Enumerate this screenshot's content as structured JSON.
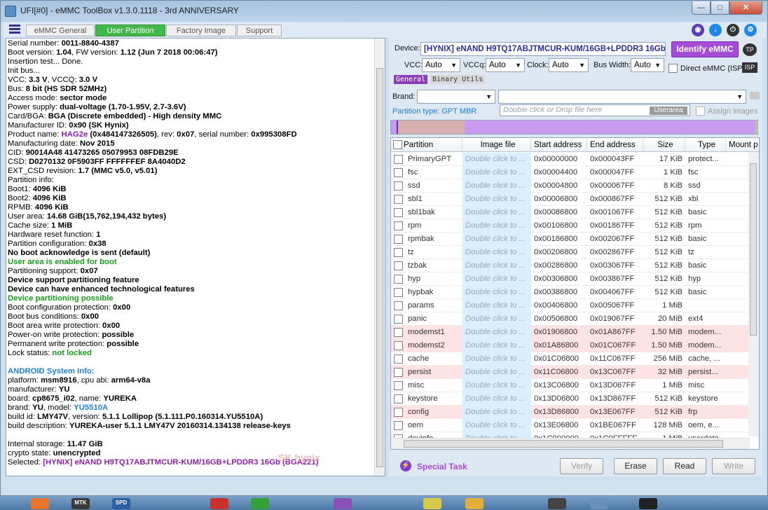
{
  "window": {
    "title": "UFI[#0] - eMMC ToolBox v1.3.0.1118 - 3rd ANNIVERSARY"
  },
  "tabs": [
    {
      "label": "eMMC General"
    },
    {
      "label": "User Partition"
    },
    {
      "label": "Factory Image"
    },
    {
      "label": "Support"
    }
  ],
  "colors": {
    "active_tab": "#42b84a",
    "identify_button": "#a64bd6",
    "partition_bar": "#c89af0"
  },
  "log": [
    {
      "k": "Serial number: ",
      "v": "0011-8840-4387"
    },
    {
      "k": " Boot version: ",
      "v": "1.04",
      "k2": ", FW version: ",
      "v2": "1.12 (Jun  7 2018 00:06:47)"
    },
    {
      "k": "Insertion test... Done."
    },
    {
      "k": "Init bus..."
    },
    {
      "k": "VCC: ",
      "v": "3.3 V",
      "k2": ", VCCQ: ",
      "v2": "3.0 V"
    },
    {
      "k": "Bus: ",
      "v": "8 bit (HS SDR 52MHz)"
    },
    {
      "k": "Access mode: ",
      "v": "sector mode"
    },
    {
      "k": "Power supply: ",
      "v": "dual-voltage (1.70-1.95V, 2.7-3.6V)"
    },
    {
      "k": " Card/BGA: ",
      "v": "BGA (Discrete embedded) - High density MMC"
    },
    {
      "k": " Manufacturer ID: ",
      "v": "0x90 (SK Hynix)"
    },
    {
      "k": " Product name: ",
      "v": "HAG2e",
      "vc": "purple",
      "k2": " ",
      "v2": "(0x484147326505)",
      "k3": ", rev: ",
      "v3": "0x07",
      "k4": ", serial number: ",
      "v4": "0x995308FD"
    },
    {
      "k": " Manufacturing date: ",
      "v": "Nov 2015"
    },
    {
      "k": "CID: ",
      "v": "90014A48 41473265 05079953 08FDB29E"
    },
    {
      "k": "CSD: ",
      "v": "D0270132 0F5903FF FFFFFFEF 8A4040D2"
    },
    {
      "k": "EXT_CSD revision: ",
      "v": "1.7 (MMC v5.0, v5.01)"
    },
    {
      "k": "Partition info:"
    },
    {
      "k": " Boot1: ",
      "v": "4096 KiB"
    },
    {
      "k": " Boot2: ",
      "v": "4096 KiB"
    },
    {
      "k": " RPMB: ",
      "v": "4096 KiB"
    },
    {
      "k": " User area: ",
      "v": "14.68 GiB(15,762,194,432 bytes)"
    },
    {
      "k": "Cache size: ",
      "v": "1 MiB"
    },
    {
      "k": "Hardware reset function: ",
      "v": "1"
    },
    {
      "k": "Partition configuration: ",
      "v": "0x38"
    },
    {
      "k": " ",
      "v": "No boot acknowledge is sent (default)"
    },
    {
      "k": " ",
      "v": "User area is enabled for boot",
      "vc": "green"
    },
    {
      "k": "Partitioning support: ",
      "v": "0x07"
    },
    {
      "k": " ",
      "v": "Device support partitioning feature"
    },
    {
      "k": " ",
      "v": "Device can have enhanced technological features"
    },
    {
      "k": " ",
      "v": "Device partitioning possible",
      "vc": "green"
    },
    {
      "k": "Boot configuration protection: ",
      "v": "0x00"
    },
    {
      "k": "Boot bus conditions: ",
      "v": "0x00"
    },
    {
      "k": "Boot area write protection: ",
      "v": "0x00"
    },
    {
      "k": " Power-on write protection: ",
      "v": "possible"
    },
    {
      "k": " Permanent write protection: ",
      "v": "possible"
    },
    {
      "k": " Lock status: ",
      "v": "not locked",
      "vc": "green"
    },
    {
      "k": ""
    },
    {
      "k": "",
      "v": "ANDROID System Info:",
      "vc": "blue"
    },
    {
      "k": " platform: ",
      "v": "msm8916",
      "k2": ", cpu abi: ",
      "v2": "arm64-v8a"
    },
    {
      "k": " manufacturer: ",
      "v": "YU"
    },
    {
      "k": " board: ",
      "v": "cp8675_i02",
      "k2": ", name: ",
      "v2": "YUREKA"
    },
    {
      "k": " brand: ",
      "v": "YU",
      "k2": ", model: ",
      "v2": "YU5510A",
      "v2c": "blue"
    },
    {
      "k": " build id: ",
      "v": "LMY47V",
      "k2": ", version: ",
      "v2": "5.1.1 Lollipop (5.1.111.P0.160314.YU5510A)"
    },
    {
      "k": " build description: ",
      "v": "YUREKA-user 5.1.1 LMY47V 20160314.134138 release-keys"
    },
    {
      "k": ""
    },
    {
      "k": "Internal storage: ",
      "v": "11.47 GiB"
    },
    {
      "k": "crypto state: ",
      "v": "unencrypted"
    },
    {
      "k": "Selected: ",
      "v": "[HYNIX] eNAND H9TQ17ABJTMCUR-KUM/16GB+LPDDR3 16Gb   (BGA221)",
      "vc": "purple"
    }
  ],
  "watermark": "SK hynix",
  "device": {
    "label": "Device:",
    "value": "[HYNIX] eNAND H9TQ17ABJTMCUR-KUM/16GB+LPDDR3 16Gb",
    "identify_label": "Identify eMMC",
    "tp_label": "TP"
  },
  "power": {
    "vcc_label": "VCC:",
    "vcc_value": "Auto",
    "vccq_label": "VCCq:",
    "vccq_value": "Auto",
    "clock_label": "Clock:",
    "clock_value": "Auto",
    "bus_label": "Bus Width:",
    "bus_value": "Auto",
    "direct_label": "Direct eMMC (ISP)",
    "isp_label": "ISP"
  },
  "subtabs": [
    {
      "label": "General"
    },
    {
      "label": "Binary Utils"
    }
  ],
  "brand": {
    "label": "Brand:",
    "value": "",
    "model_value": ""
  },
  "partition_type": "Partition type: GPT MBR",
  "drop_placeholder": "Double click or Drop file here",
  "userarea_label": "Userarea",
  "assign_images_label": "Assign images",
  "grid": {
    "headers": [
      "Partition",
      "Image file",
      "Start address",
      "End address",
      "Size",
      "Type",
      "Mount p"
    ],
    "image_placeholder": "Double click to ...",
    "rows": [
      {
        "name": "PrimaryGPT",
        "start": "0x00000000",
        "end": "0x000043FF",
        "size": "17 KiB",
        "type": "protect...",
        "pink": false
      },
      {
        "name": "fsc",
        "start": "0x00004400",
        "end": "0x000047FF",
        "size": "1 KiB",
        "type": "fsc",
        "pink": false
      },
      {
        "name": "ssd",
        "start": "0x00004800",
        "end": "0x000067FF",
        "size": "8 KiB",
        "type": "ssd",
        "pink": false
      },
      {
        "name": "sbl1",
        "start": "0x00006800",
        "end": "0x000867FF",
        "size": "512 KiB",
        "type": "xbl",
        "pink": false
      },
      {
        "name": "sbl1bak",
        "start": "0x00086800",
        "end": "0x001067FF",
        "size": "512 KiB",
        "type": "basic",
        "pink": false
      },
      {
        "name": "rpm",
        "start": "0x00106800",
        "end": "0x001867FF",
        "size": "512 KiB",
        "type": "rpm",
        "pink": false
      },
      {
        "name": "rpmbak",
        "start": "0x00186800",
        "end": "0x002067FF",
        "size": "512 KiB",
        "type": "basic",
        "pink": false
      },
      {
        "name": "tz",
        "start": "0x00206800",
        "end": "0x002867FF",
        "size": "512 KiB",
        "type": "tz",
        "pink": false
      },
      {
        "name": "tzbak",
        "start": "0x00286800",
        "end": "0x003067FF",
        "size": "512 KiB",
        "type": "basic",
        "pink": false
      },
      {
        "name": "hyp",
        "start": "0x00306800",
        "end": "0x003867FF",
        "size": "512 KiB",
        "type": "hyp",
        "pink": false
      },
      {
        "name": "hypbak",
        "start": "0x00386800",
        "end": "0x004067FF",
        "size": "512 KiB",
        "type": "basic",
        "pink": false
      },
      {
        "name": "params",
        "start": "0x00406800",
        "end": "0x005067FF",
        "size": "1 MiB",
        "type": "",
        "pink": false
      },
      {
        "name": "panic",
        "start": "0x00506800",
        "end": "0x019067FF",
        "size": "20 MiB",
        "type": "ext4",
        "pink": false
      },
      {
        "name": "modemst1",
        "start": "0x01906800",
        "end": "0x01A867FF",
        "size": "1.50 MiB",
        "type": "modem...",
        "pink": true
      },
      {
        "name": "modemst2",
        "start": "0x01A86800",
        "end": "0x01C067FF",
        "size": "1.50 MiB",
        "type": "modem...",
        "pink": true
      },
      {
        "name": "cache",
        "start": "0x01C06800",
        "end": "0x11C067FF",
        "size": "256 MiB",
        "type": "cache, ...",
        "pink": false
      },
      {
        "name": "persist",
        "start": "0x11C06800",
        "end": "0x13C067FF",
        "size": "32 MiB",
        "type": "persist...",
        "pink": true
      },
      {
        "name": "misc",
        "start": "0x13C06800",
        "end": "0x13D067FF",
        "size": "1 MiB",
        "type": "misc",
        "pink": false
      },
      {
        "name": "keystore",
        "start": "0x13D06800",
        "end": "0x13D867FF",
        "size": "512 KiB",
        "type": "keystore",
        "pink": false
      },
      {
        "name": "config",
        "start": "0x13D86800",
        "end": "0x13E067FF",
        "size": "512 KiB",
        "type": "frp",
        "pink": true
      },
      {
        "name": "oem",
        "start": "0x13E06800",
        "end": "0x1BE067FF",
        "size": "128 MiB",
        "type": "oem, e...",
        "pink": false
      },
      {
        "name": "devinfo",
        "start": "0x1C000000",
        "end": "0x1C0FFFFF",
        "size": "1 MiB",
        "type": "userdata",
        "pink": false
      }
    ]
  },
  "actions": {
    "special_task": "Special Task",
    "verify": "Verify",
    "erase": "Erase",
    "read": "Read",
    "write": "Write"
  },
  "taskbar": [
    {
      "label": "",
      "icon": "firefox-icon",
      "color": "#e8752a"
    },
    {
      "label": "MTK",
      "icon": "mtk-icon",
      "color": "#3a3a3a"
    },
    {
      "label": "SPD",
      "icon": "spd-icon",
      "color": "#2a5fa8"
    },
    {
      "label": "",
      "icon": "tool-icon",
      "color": "#c8322a"
    },
    {
      "label": "",
      "icon": "play-icon",
      "color": "#34a03a"
    },
    {
      "label": "",
      "icon": "ufi-icon",
      "color": "#8a4fb8"
    },
    {
      "label": "",
      "icon": "mail-icon",
      "color": "#d9c94a"
    },
    {
      "label": "",
      "icon": "folder-icon",
      "color": "#e2b03a"
    },
    {
      "label": "",
      "icon": "chip-icon",
      "color": "#444"
    },
    {
      "label": "",
      "icon": "window-icon",
      "color": "#6a8fb8"
    },
    {
      "label": "",
      "icon": "qq-icon",
      "color": "#222"
    }
  ]
}
